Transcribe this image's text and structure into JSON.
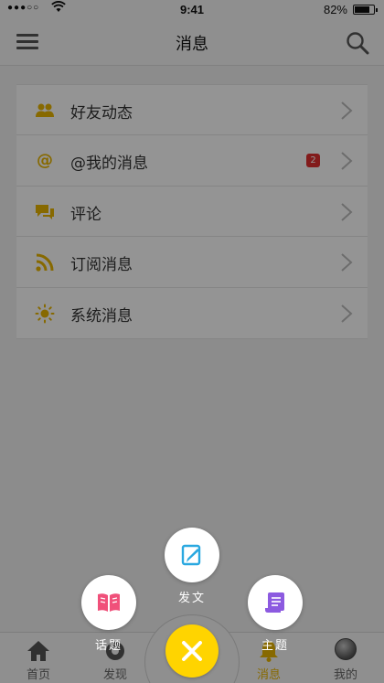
{
  "status_bar": {
    "signal": "●●●○○",
    "time": "9:41",
    "battery": "82%",
    "battery_level": 0.82
  },
  "header": {
    "title": "消息"
  },
  "messages": {
    "items": [
      {
        "label": "好友动态",
        "icon": "friends-icon"
      },
      {
        "label": "@我的消息",
        "icon": "at-icon",
        "badge": "2"
      },
      {
        "label": "评论",
        "icon": "comment-icon"
      },
      {
        "label": "订阅消息",
        "icon": "rss-icon"
      },
      {
        "label": "系统消息",
        "icon": "sun-icon"
      }
    ]
  },
  "compose_menu": {
    "post": "发文",
    "topic": "话题",
    "theme": "主题"
  },
  "tabbar": {
    "items": [
      {
        "label": "首页",
        "icon": "home-icon"
      },
      {
        "label": "发现",
        "icon": "discover-icon"
      },
      {
        "label": "消息",
        "icon": "bell-icon",
        "active": true
      },
      {
        "label": "我的",
        "icon": "avatar"
      }
    ]
  },
  "colors": {
    "accent": "#e8b600",
    "fab": "#ffd400",
    "badge": "#e0302f",
    "post_icon": "#2aa8e0",
    "topic_icon": "#f0507a",
    "theme_icon": "#8c5ae0"
  }
}
